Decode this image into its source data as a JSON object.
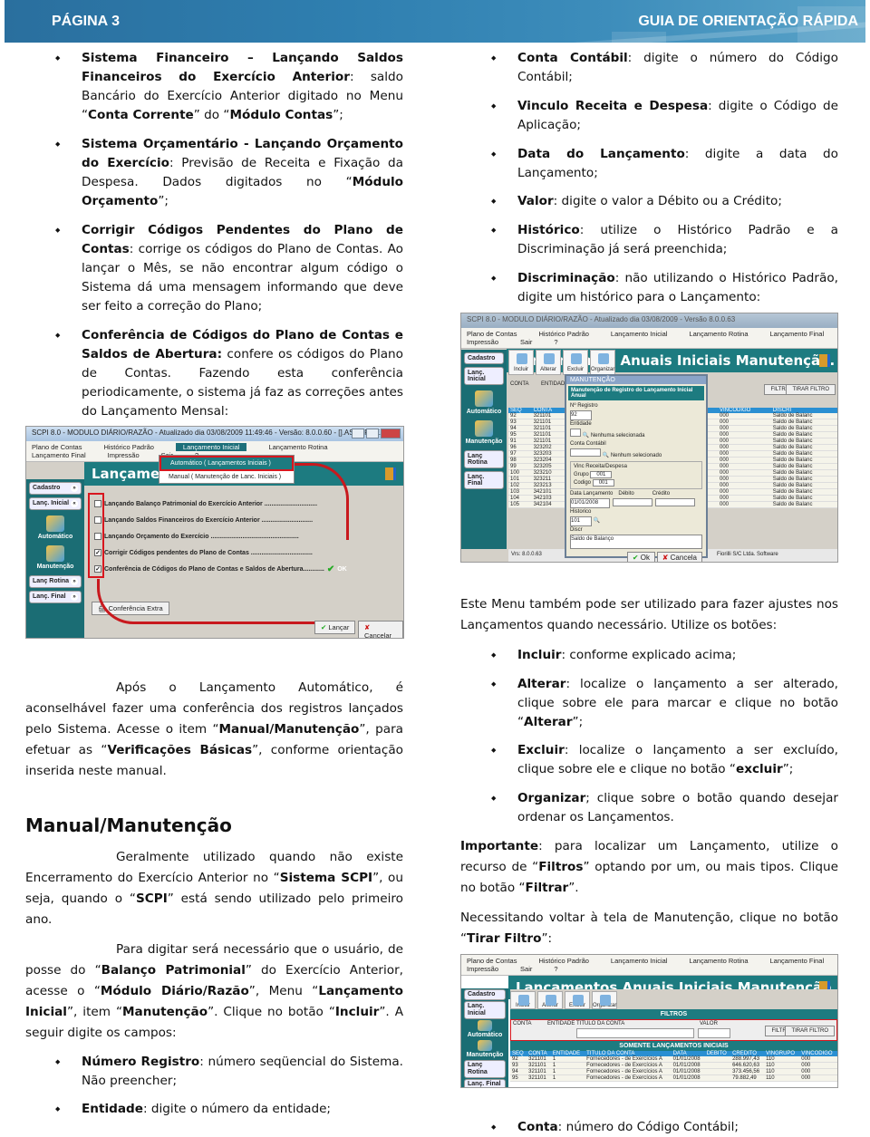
{
  "header": {
    "left": "PÁGINA 3",
    "right": "GUIA DE ORIENTAÇÃO RÁPIDA"
  },
  "left": {
    "bullets": [
      [
        {
          "t": "Sistema Financeiro – Lançando Saldos Financeiros do Exercício Anterior",
          "b": true
        },
        {
          "t": ": saldo Bancário do Exercício Anterior digitado no Menu “"
        },
        {
          "t": "Conta Corrente",
          "b": true
        },
        {
          "t": "” do “"
        },
        {
          "t": "Módulo Contas",
          "b": true
        },
        {
          "t": "”;"
        }
      ],
      [
        {
          "t": "Sistema Orçamentário - Lançando Orçamento do Exercício",
          "b": true
        },
        {
          "t": ": Previsão de Receita e Fixação da Despesa. Dados digitados no “"
        },
        {
          "t": "Módulo Orçamento",
          "b": true
        },
        {
          "t": "”;"
        }
      ],
      [
        {
          "t": "Corrigir Códigos Pendentes do Plano de Contas",
          "b": true
        },
        {
          "t": ": corrige os códigos do Plano de Contas. Ao lançar o Mês, se não encontrar algum código o Sistema dá uma mensagem informando que deve ser feito a correção do Plano;"
        }
      ],
      [
        {
          "t": "Conferência de Códigos do Plano de Contas e Saldos de Abertura:",
          "b": true
        },
        {
          "t": " confere os códigos do Plano de Contas. Fazendo esta conferência periodicamente, o sistema já faz as correções antes do Lançamento Mensal:"
        }
      ]
    ],
    "para_apos": [
      {
        "t": "Após o Lançamento Automático, é aconselhável fazer uma conferência dos registros lançados pelo Sistema. Acesse o item “"
      },
      {
        "t": "Manual/Manutenção",
        "b": true
      },
      {
        "t": "”, para efetuar as “"
      },
      {
        "t": "Verificações Básicas",
        "b": true
      },
      {
        "t": "”, conforme orientação inserida neste manual."
      }
    ],
    "heading": "Manual/Manutenção",
    "para_geral": [
      {
        "t": "Geralmente utilizado quando não existe Encerramento do Exercício Anterior no “"
      },
      {
        "t": "Sistema SCPI",
        "b": true
      },
      {
        "t": "”, ou seja, quando o “"
      },
      {
        "t": "SCPI",
        "b": true
      },
      {
        "t": "” está sendo utilizado pelo primeiro ano."
      }
    ],
    "para_digitar": [
      {
        "t": "Para digitar será necessário que o usuário, de posse do “"
      },
      {
        "t": "Balanço Patrimonial",
        "b": true
      },
      {
        "t": "” do Exercício Anterior, acesse o “"
      },
      {
        "t": "Módulo Diário/Razão",
        "b": true
      },
      {
        "t": "”, Menu “"
      },
      {
        "t": "Lançamento Inicial",
        "b": true
      },
      {
        "t": "”, item “"
      },
      {
        "t": "Manutenção",
        "b": true
      },
      {
        "t": "”. Clique no botão “"
      },
      {
        "t": "Incluir",
        "b": true
      },
      {
        "t": "”. A seguir digite os campos:"
      }
    ],
    "bullets2": [
      [
        {
          "t": "Número Registro",
          "b": true
        },
        {
          "t": ": número seqüencial do Sistema. Não preencher;"
        }
      ],
      [
        {
          "t": "Entidade",
          "b": true
        },
        {
          "t": ": digite o número da entidade;"
        }
      ]
    ]
  },
  "right": {
    "bullets": [
      [
        {
          "t": "Conta Contábil",
          "b": true
        },
        {
          "t": ": digite o número do Código Contábil;"
        }
      ],
      [
        {
          "t": "Vinculo Receita e Despesa",
          "b": true
        },
        {
          "t": ": digite o Código de Aplicação;"
        }
      ],
      [
        {
          "t": "Data do Lançamento",
          "b": true
        },
        {
          "t": ": digite a data do Lançamento;"
        }
      ],
      [
        {
          "t": "Valor",
          "b": true
        },
        {
          "t": ": digite o valor a Débito ou a Crédito;"
        }
      ],
      [
        {
          "t": "Histórico",
          "b": true
        },
        {
          "t": ": utilize o Histórico Padrão e a Discriminação já será preenchida;"
        }
      ],
      [
        {
          "t": "Discriminação",
          "b": true
        },
        {
          "t": ": não utilizando o Histórico Padrão, digite um histórico para o Lançamento:"
        }
      ]
    ],
    "para_menu": [
      {
        "t": "Este Menu também pode ser utilizado para fazer ajustes nos Lançamentos quando necessário. Utilize os botões:"
      }
    ],
    "bullets2": [
      [
        {
          "t": "Incluir",
          "b": true
        },
        {
          "t": ": conforme explicado acima;"
        }
      ],
      [
        {
          "t": "Alterar",
          "b": true
        },
        {
          "t": ": localize o lançamento a ser alterado, clique sobre ele para marcar e clique no botão “"
        },
        {
          "t": "Alterar",
          "b": true
        },
        {
          "t": "”;"
        }
      ],
      [
        {
          "t": "Excluir",
          "b": true
        },
        {
          "t": ": localize o lançamento a ser excluído, clique sobre ele e clique no botão “"
        },
        {
          "t": "excluir",
          "b": true
        },
        {
          "t": "”;"
        }
      ],
      [
        {
          "t": "Organizar",
          "b": true
        },
        {
          "t": "; clique sobre o botão quando desejar ordenar os Lançamentos."
        }
      ]
    ],
    "para_importante": [
      {
        "t": "Importante",
        "b": true
      },
      {
        "t": ": para localizar um Lançamento, utilize o recurso de “"
      },
      {
        "t": "Filtros",
        "b": true
      },
      {
        "t": "” optando por um, ou mais tipos. Clique no botão “"
      },
      {
        "t": "Filtrar",
        "b": true
      },
      {
        "t": "”."
      }
    ],
    "para_voltar": [
      {
        "t": "Necessitando voltar à tela de Manutenção, clique no botão “"
      },
      {
        "t": "Tirar Filtro",
        "b": true
      },
      {
        "t": "”:"
      }
    ],
    "bullet_last": [
      {
        "t": "Conta",
        "b": true
      },
      {
        "t": ": número do Código Contábil;"
      }
    ]
  },
  "shot1": {
    "title": "SCPI 8.0 - MODULO DIÁRIO/RAZÃO - Atualizado dia 03/08/2009 11:49:46 - Versão: 8.0.0.60 - [].ASCURRE..",
    "menu": [
      "Plano de Contas",
      "Histórico Padrão",
      "Lançamento Inicial",
      "Lançamento Rotina",
      "Lançamento Final",
      "Impressão",
      "Sair",
      "?"
    ],
    "banner": "Lançamen",
    "dropdown": [
      "Automático ( Lançamentos Iniciais )",
      "Manual ( Manutenção de Lanc. Iniciais )"
    ],
    "sidebar": [
      "Cadastro",
      "Lanç. Inicial",
      "Automático",
      "Manutenção",
      "Lanç Rotina",
      "Lanç. Final"
    ],
    "checks": [
      {
        "label": "Lançando Balanço Patrimonial do Exercício Anterior ..............................",
        "checked": false
      },
      {
        "label": "Lançando Saldos Financeiros do Exercício Anterior .............................",
        "checked": false
      },
      {
        "label": "Lançando Orçamento do Exercício ..................................................",
        "checked": false
      },
      {
        "label": "Corrigir Códigos pendentes do Plano de Contas ...................................",
        "checked": true
      },
      {
        "label": "Conferência de Códigos do Plano de Contas e Saldos de Abertura............",
        "checked": true
      }
    ],
    "ok": "OK",
    "extra": "Conferência Extra",
    "lancar": "Lançar",
    "cancelar": "Cancelar"
  },
  "shot2": {
    "title": "SCPI 8.0 - MODULO DIÁRIO/RAZÃO - Atualizado dia 03/08/2009 - Versão 8.0.0.63",
    "menu": [
      "Plano de Contas",
      "Histórico Padrão",
      "Lançamento Inicial",
      "Lançamento Rotina",
      "Lançamento Final",
      "Impressão",
      "Sair",
      "?"
    ],
    "banner": "Lançamentos Anuais Iniciais Manutenção.",
    "tools": [
      "Incluir",
      "Alterar",
      "Excluir",
      "Organizar"
    ],
    "sidebar": [
      "Cadastro",
      "Lanç. Inicial",
      "Automático",
      "Manutenção",
      "Lanç Rotina",
      "Lanç. Final"
    ],
    "filters": {
      "conta": "CONTA",
      "entidade": "ENTIDADE",
      "filtrar": "FILTRAR",
      "tirar": "TIRAR FILTRO"
    },
    "cols": [
      "SEQ",
      "CONTA",
      "ENTIDADE",
      "CREDITO",
      "VINGRUPO",
      "VINCODIGO",
      "DISCRI"
    ],
    "rows": [
      [
        "92",
        "321101",
        "1",
        "288.997,43",
        "110",
        "000",
        "Saldo de Balanc"
      ],
      [
        "93",
        "321101",
        "1",
        "646.620,63",
        "110",
        "000",
        "Saldo de Balanc"
      ],
      [
        "94",
        "321101",
        "1",
        "373.456,56",
        "110",
        "000",
        "Saldo de Balanc"
      ],
      [
        "95",
        "321101",
        "1",
        "79.882,49",
        "110",
        "000",
        "Saldo de Balanc"
      ],
      [
        "91",
        "321101",
        "1",
        "14.144,48",
        "110",
        "000",
        "Saldo de Balanc"
      ],
      [
        "96",
        "323202",
        "1",
        "3.872,08",
        "110",
        "000",
        "Saldo de Balanc"
      ],
      [
        "97",
        "323203",
        "1",
        "8,10",
        "110",
        "000",
        "Saldo de Balanc"
      ],
      [
        "98",
        "323204",
        "1",
        "21.618,10",
        "110",
        "000",
        "Saldo de Balanc"
      ],
      [
        "99",
        "323205",
        "1",
        "1.655,93",
        "110",
        "000",
        "Saldo de Balanc"
      ],
      [
        "100",
        "323210",
        "1",
        "4.192,01",
        "110",
        "000",
        "Saldo de Balanc"
      ],
      [
        "101",
        "323211",
        "1",
        "57,99",
        "110",
        "000",
        "Saldo de Balanc"
      ],
      [
        "102",
        "323213",
        "1",
        "3.152,57",
        "110",
        "000",
        "Saldo de Balanc"
      ],
      [
        "103",
        "342101",
        "1",
        "69.550,28",
        "110",
        "000",
        "Saldo de Balanc"
      ],
      [
        "104",
        "342103",
        "1",
        "62.936,01",
        "110",
        "000",
        "Saldo de Balanc"
      ],
      [
        "105",
        "342104",
        "1",
        "2.002.360,25",
        "110",
        "000",
        "Saldo de Balanc"
      ]
    ],
    "dialog": {
      "title": "MANUTENÇÃO",
      "header": "Manutenção de Registro do Lançamento Inicial Anual",
      "nreg_label": "Nº Registro",
      "nreg": "92",
      "entidade_label": "Entidade",
      "entidade_none": "Nenhuma selecionada",
      "conta_label": "Conta Contábil",
      "conta_none": "Nenhum selecionado",
      "vinc_label": "Vinc Receita/Despesa",
      "grupo_label": "Grupo",
      "grupo": "001",
      "codigo_label": "Codigo",
      "codigo": "001",
      "data_label": "Data Lançamento",
      "data": "01/01/2008",
      "debito_label": "Débito",
      "credito_label": "Crédito",
      "hist_label": "Historico",
      "hist": "101",
      "discr_label": "Discr",
      "discr": "Saldo de Balanço",
      "ok": "Ok",
      "cancel": "Cancela"
    },
    "status_version": "Vrs: 8.0.0.63",
    "status_company": "Fiorilli S/C Ltda. Software",
    "ok": "Ok",
    "cancel": "Cancela"
  },
  "shot3": {
    "menu": [
      "Plano de Contas",
      "Histórico Padrão",
      "Lançamento Inicial",
      "Lançamento Rotina",
      "Lançamento Final",
      "Impressão",
      "Sair",
      "?"
    ],
    "banner": "Lançamentos Anuais Iniciais Manutenção.",
    "tools": [
      "Incluir",
      "Alterar",
      "Excluir",
      "Organizar"
    ],
    "sidebar": [
      "Cadastro",
      "Lanç. Inicial",
      "Automático",
      "Manutenção",
      "Lanç Rotina",
      "Lanç. Final"
    ],
    "filtros": "FILTROS",
    "filter_labels": [
      "CONTA",
      "ENTIDADE",
      "TITULO DA CONTA",
      "VALOR"
    ],
    "filtrar": "FILTRAR",
    "tirar": "TIRAR FILTRO",
    "somente": "SOMENTE LANÇAMENTOS INICIAIS",
    "cols": [
      "SEQ",
      "CONTA",
      "ENTIDADE",
      "TITULO DA CONTA",
      "DATA",
      "DEBITO",
      "CREDITO",
      "VINGRUPO",
      "VINCODIGO"
    ],
    "rows": [
      [
        "92",
        "321101",
        "1",
        "Fornecedores - de Exercícios A",
        "01/01/2008",
        "",
        "288.997,43",
        "110",
        "000"
      ],
      [
        "93",
        "321101",
        "1",
        "Fornecedores - de Exercícios A",
        "01/01/2008",
        "",
        "646.620,63",
        "110",
        "000"
      ],
      [
        "94",
        "321101",
        "1",
        "Fornecedores - de Exercícios A",
        "01/01/2008",
        "",
        "373.456,56",
        "110",
        "000"
      ],
      [
        "95",
        "321101",
        "1",
        "Fornecedores - de Exercícios A",
        "01/01/2008",
        "",
        "79.882,49",
        "110",
        "000"
      ]
    ]
  }
}
